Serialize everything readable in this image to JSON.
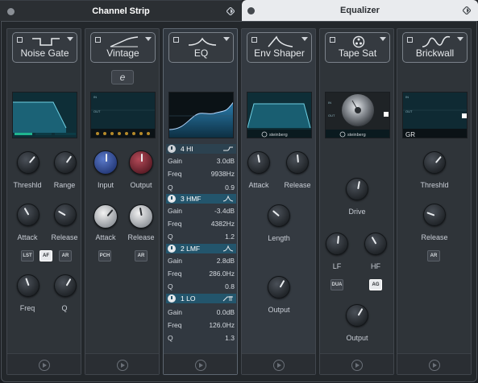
{
  "tabs": [
    {
      "title": "Channel Strip",
      "active": true
    },
    {
      "title": "Equalizer",
      "active": false
    }
  ],
  "modules": {
    "noise_gate": {
      "name": "Noise Gate",
      "knobs": [
        "Threshld",
        "Range",
        "Attack",
        "Release",
        "Freq",
        "Q"
      ],
      "buttons": [
        "LST",
        "AF",
        "AR"
      ]
    },
    "vintage": {
      "name": "Vintage",
      "mode_button": "e",
      "knobs": [
        "Input",
        "Output",
        "Attack",
        "Release"
      ],
      "buttons": [
        "PCH",
        "AR"
      ]
    },
    "eq": {
      "name": "EQ",
      "bands": [
        {
          "name": "4 HI",
          "gain": "3.0dB",
          "freq": "9938Hz",
          "q": "0.9"
        },
        {
          "name": "3 HMF",
          "gain": "-3.4dB",
          "freq": "4382Hz",
          "q": "1.2"
        },
        {
          "name": "2 LMF",
          "gain": "2.8dB",
          "freq": "286.0Hz",
          "q": "0.8"
        },
        {
          "name": "1 LO",
          "gain": "0.0dB",
          "freq": "126.0Hz",
          "q": "1.3"
        }
      ],
      "param_labels": {
        "gain": "Gain",
        "freq": "Freq",
        "q": "Q"
      }
    },
    "env_shaper": {
      "name": "Env Shaper",
      "brand": "steinberg",
      "knobs": [
        "Attack",
        "Release",
        "Length",
        "Output"
      ]
    },
    "tape_sat": {
      "name": "Tape Sat",
      "brand": "steinberg",
      "knobs": [
        "Drive",
        "LF",
        "HF",
        "Output"
      ],
      "buttons": [
        "DUA",
        "AG"
      ]
    },
    "brickwall": {
      "name": "Brickwall",
      "meter_label": "GR",
      "knobs": [
        "Threshld",
        "Release"
      ],
      "buttons": [
        "AR"
      ]
    }
  },
  "screen_labels": {
    "in": "IN",
    "out": "OUT"
  },
  "colors": {
    "accent_teal": "#23556c",
    "screen_bg": "#0e2e37",
    "meter_green": "#1fb58f"
  }
}
